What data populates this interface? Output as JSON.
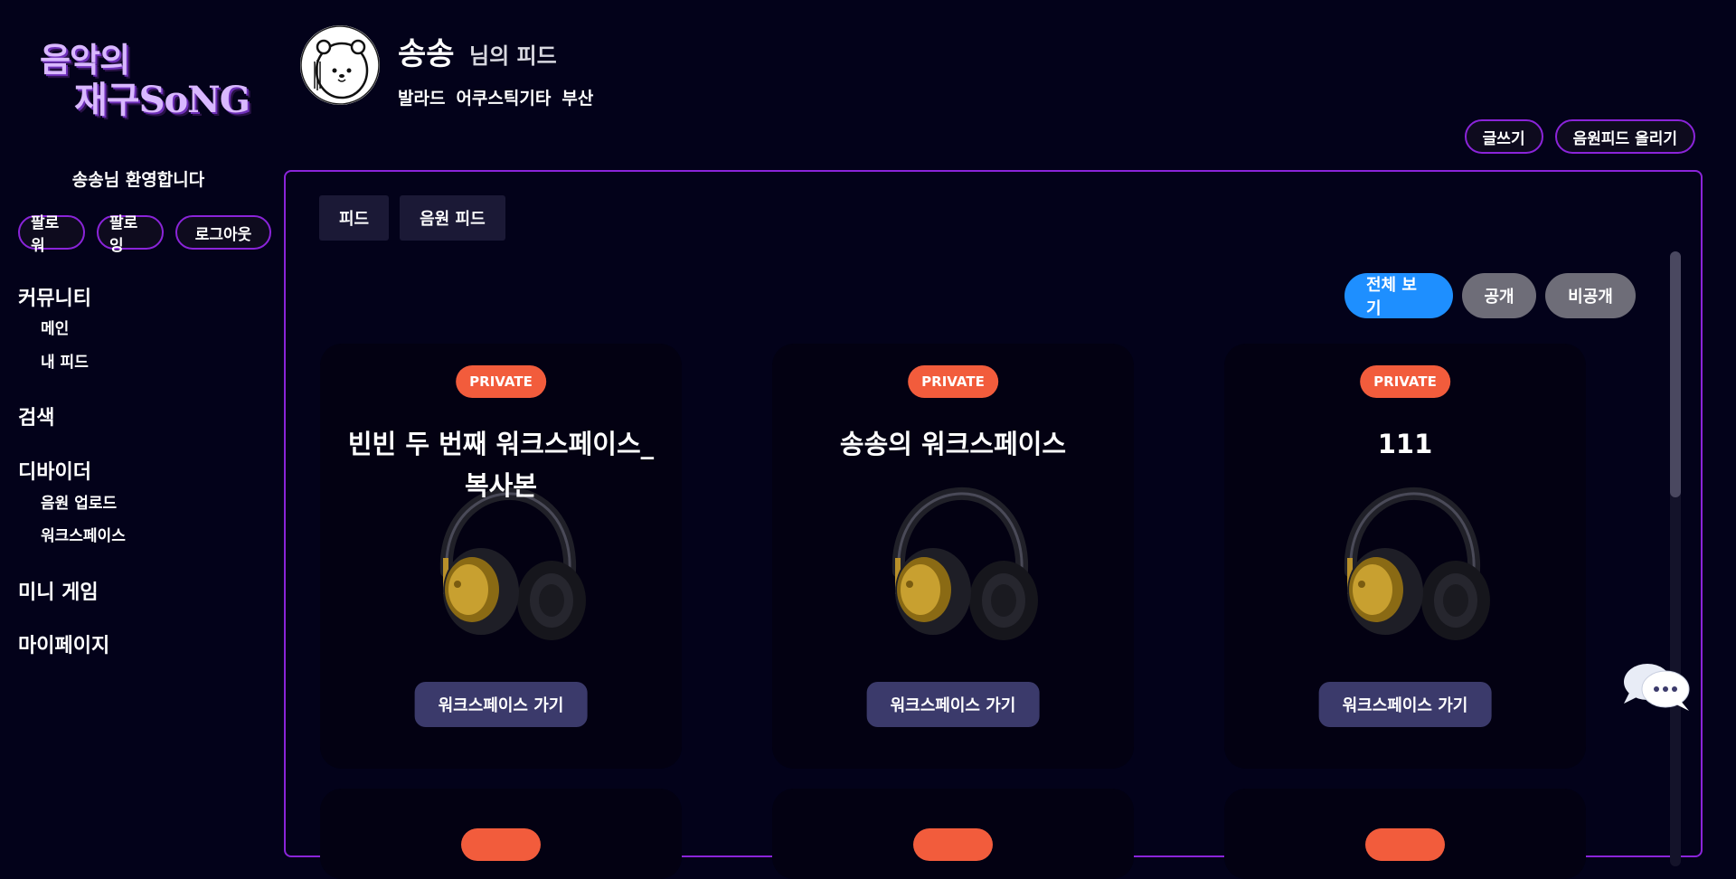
{
  "logo": {
    "line1": "음악의",
    "line2": "재구SoNG"
  },
  "sidebar": {
    "welcome": "송송님 환영합니다",
    "buttons": {
      "follower": "팔로워",
      "following": "팔로잉",
      "logout": "로그아웃"
    },
    "sections": [
      {
        "title": "커뮤니티",
        "items": [
          "메인",
          "내 피드"
        ]
      },
      {
        "title": "검색",
        "items": []
      },
      {
        "title": "디바이더",
        "items": [
          "음원 업로드",
          "워크스페이스"
        ]
      },
      {
        "title": "미니 게임",
        "items": []
      },
      {
        "title": "마이페이지",
        "items": []
      }
    ]
  },
  "header": {
    "user_name": "송송",
    "feed_suffix": "님의 피드",
    "tags": [
      "발라드",
      "어쿠스틱기타",
      "부산"
    ],
    "actions": {
      "write": "글쓰기",
      "upload_feed": "음원피드 올리기"
    }
  },
  "panel": {
    "tabs": [
      "피드",
      "음원 피드"
    ],
    "filters": {
      "all": "전체 보기",
      "public": "공개",
      "private": "비공개"
    },
    "cards": [
      {
        "badge": "PRIVATE",
        "title": "빈빈 두 번째 워크스페이스_복사본",
        "button": "워크스페이스 가기"
      },
      {
        "badge": "PRIVATE",
        "title": "송송의 워크스페이스",
        "button": "워크스페이스 가기"
      },
      {
        "badge": "PRIVATE",
        "title": "111",
        "button": "워크스페이스 가기"
      }
    ]
  },
  "colors": {
    "background": "#03021a",
    "accent_border": "#8a24d9",
    "badge": "#f25c3c",
    "filter_active": "#1e8fff",
    "filter_inactive": "#6e6d78",
    "card_button": "#3b3a6b"
  }
}
